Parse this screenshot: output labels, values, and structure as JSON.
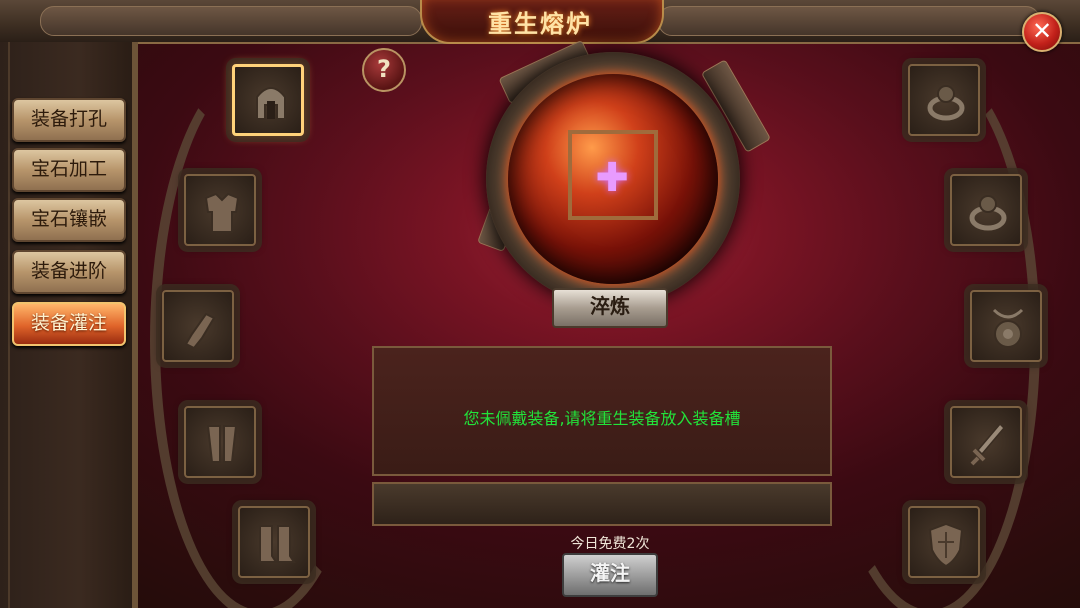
{
  "header": {
    "title": "重生熔炉",
    "close_icon": "close-icon"
  },
  "nav": {
    "items": [
      {
        "label": "装备打孔"
      },
      {
        "label": "宝石加工"
      },
      {
        "label": "宝石镶嵌"
      },
      {
        "label": "装备进阶"
      },
      {
        "label": "装备灌注",
        "active": true
      }
    ]
  },
  "help": {
    "label": "?"
  },
  "furnace": {
    "plus_glyph": "✚",
    "refine_label": "淬炼"
  },
  "message": {
    "text": "您未佩戴装备,请将重生装备放入装备槽"
  },
  "footer": {
    "free_count_text": "今日免费2次",
    "infuse_label": "灌注"
  },
  "slots": {
    "left": [
      "helmet-icon",
      "armor-icon",
      "gauntlet-icon",
      "leg-armor-icon",
      "boots-icon"
    ],
    "right": [
      "ring-icon",
      "ring-icon",
      "amulet-icon",
      "sword-icon",
      "shield-icon"
    ],
    "selected": "helmet-icon"
  },
  "colors": {
    "message_text": "#22e33a",
    "active_nav": "#e0642a",
    "title_glow": "#ff8a2a"
  }
}
